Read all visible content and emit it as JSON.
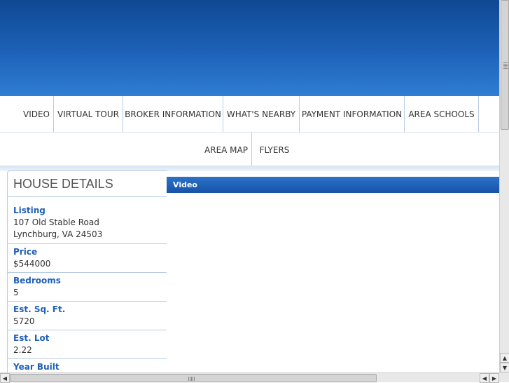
{
  "nav": {
    "row1": [
      "VIDEO",
      "VIRTUAL TOUR",
      "BROKER INFORMATION",
      "WHAT'S NEARBY",
      "PAYMENT INFORMATION",
      "AREA SCHOOLS"
    ],
    "row2": [
      "AREA MAP",
      "FLYERS"
    ]
  },
  "details": {
    "title": "HOUSE DETAILS",
    "listing_label": "Listing",
    "listing_line1": "107 Old Stable Road",
    "listing_line2": "Lynchburg, VA 24503",
    "price_label": "Price",
    "price_value": "$544000",
    "bedrooms_label": "Bedrooms",
    "bedrooms_value": "5",
    "sqft_label": "Est. Sq. Ft.",
    "sqft_value": "5720",
    "lot_label": "Est. Lot",
    "lot_value": "2.22",
    "year_label": "Year Built"
  },
  "video": {
    "title": "Video"
  },
  "colors": {
    "header_top": "#0f4893",
    "header_bottom": "#2f7ed4",
    "label_blue": "#1f5fb8",
    "divider": "#b7cde4"
  }
}
